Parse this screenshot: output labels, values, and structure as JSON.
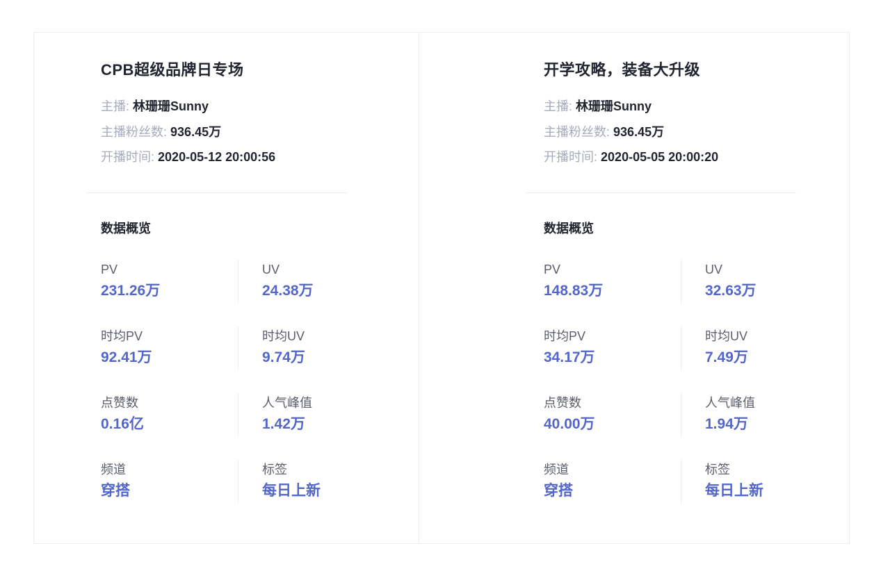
{
  "cards": [
    {
      "title": "CPB超级品牌日专场",
      "meta": [
        {
          "label": "主播:",
          "value": "林珊珊Sunny"
        },
        {
          "label": "主播粉丝数:",
          "value": "936.45万"
        },
        {
          "label": "开播时间:",
          "value": "2020-05-12 20:00:56"
        }
      ],
      "section_title": "数据概览",
      "stats": [
        {
          "label": "PV",
          "value": "231.26万"
        },
        {
          "label": "UV",
          "value": "24.38万"
        },
        {
          "label": "时均PV",
          "value": "92.41万"
        },
        {
          "label": "时均UV",
          "value": "9.74万"
        },
        {
          "label": "点赞数",
          "value": "0.16亿"
        },
        {
          "label": "人气峰值",
          "value": "1.42万"
        },
        {
          "label": "频道",
          "value": "穿搭"
        },
        {
          "label": "标签",
          "value": "每日上新"
        }
      ]
    },
    {
      "title": "开学攻略，装备大升级",
      "meta": [
        {
          "label": "主播:",
          "value": "林珊珊Sunny"
        },
        {
          "label": "主播粉丝数:",
          "value": "936.45万"
        },
        {
          "label": "开播时间:",
          "value": "2020-05-05 20:00:20"
        }
      ],
      "section_title": "数据概览",
      "stats": [
        {
          "label": "PV",
          "value": "148.83万"
        },
        {
          "label": "UV",
          "value": "32.63万"
        },
        {
          "label": "时均PV",
          "value": "34.17万"
        },
        {
          "label": "时均UV",
          "value": "7.49万"
        },
        {
          "label": "点赞数",
          "value": "40.00万"
        },
        {
          "label": "人气峰值",
          "value": "1.94万"
        },
        {
          "label": "频道",
          "value": "穿搭"
        },
        {
          "label": "标签",
          "value": "每日上新"
        }
      ]
    }
  ],
  "colors": {
    "accent": "#5366c9",
    "text": "#222530",
    "muted": "#a7abbb",
    "border": "#ececf0"
  }
}
